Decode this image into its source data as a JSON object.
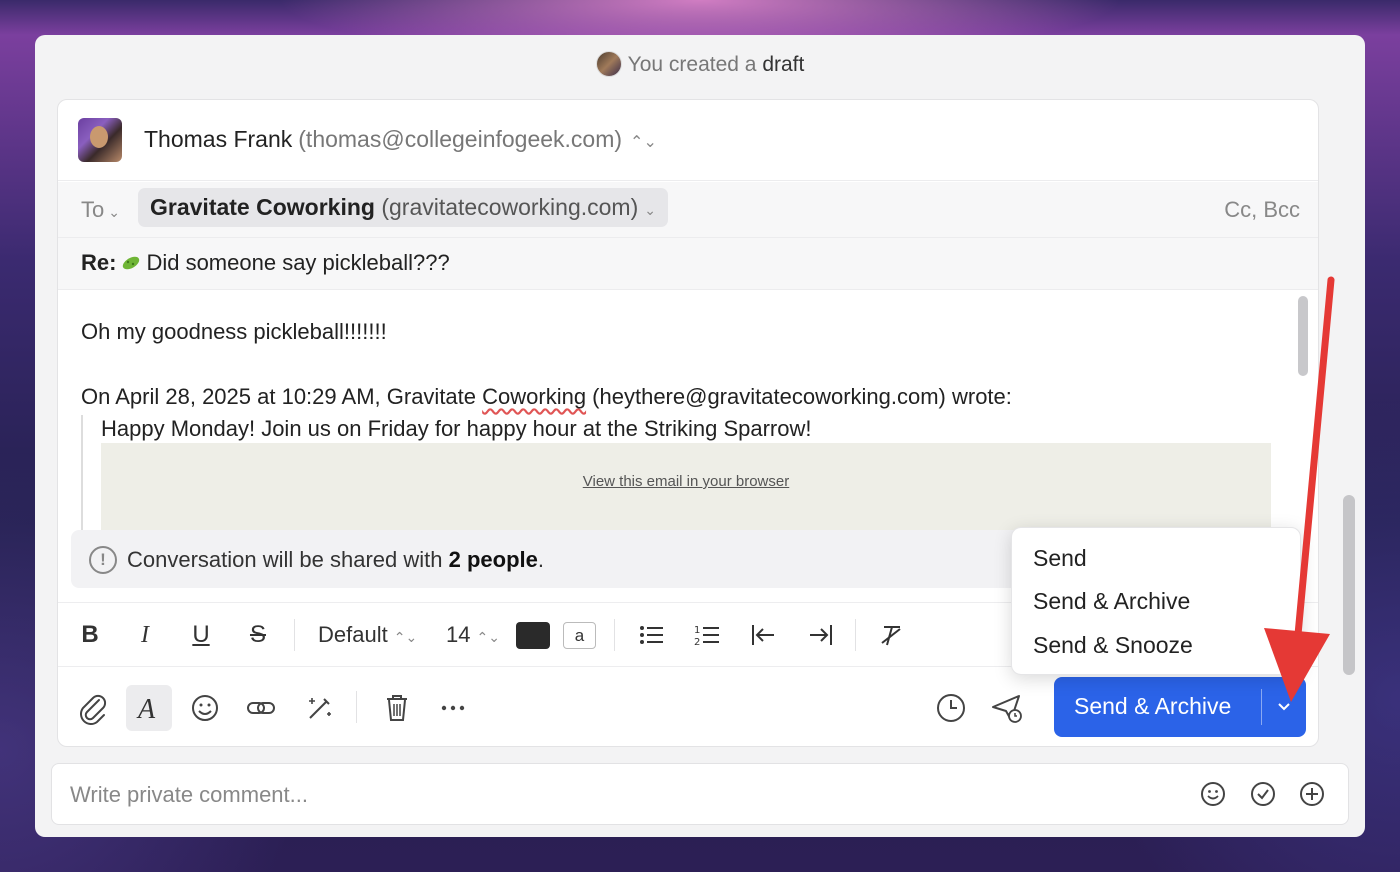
{
  "banner": {
    "prefix": "You created a",
    "highlight": "draft"
  },
  "from": {
    "name": "Thomas Frank",
    "email": "(thomas@collegeinfogeek.com)"
  },
  "to": {
    "label": "To",
    "recipient_name": "Gravitate Coworking",
    "recipient_email": "(gravitatecoworking.com)",
    "cc_bcc": "Cc, Bcc"
  },
  "subject": {
    "prefix": "Re:",
    "text": "Did someone say pickleball???"
  },
  "body": {
    "line1": "Oh my goodness pickleball!!!!!!!",
    "quote_intro_start": "On April 28, 2025 at 10:29 AM, Gravitate ",
    "quote_intro_flagged": "Coworking",
    "quote_intro_end": " (heythere@gravitatecoworking.com) wrote:",
    "quote_line": "Happy Monday! Join us on Friday for happy hour at the Striking Sparrow!",
    "view_link": "View this email in your browser"
  },
  "share_notice": {
    "prefix": "Conversation will be shared with",
    "bold": "2 people",
    "suffix": "."
  },
  "toolbar": {
    "font": "Default",
    "size": "14",
    "highlight_letter": "a"
  },
  "send": {
    "label": "Send & Archive"
  },
  "dropdown": {
    "items": [
      "Send",
      "Send & Archive",
      "Send & Snooze"
    ]
  },
  "comment": {
    "placeholder": "Write private comment..."
  },
  "colors": {
    "accent": "#2b63e8",
    "arrow": "#e53935"
  }
}
